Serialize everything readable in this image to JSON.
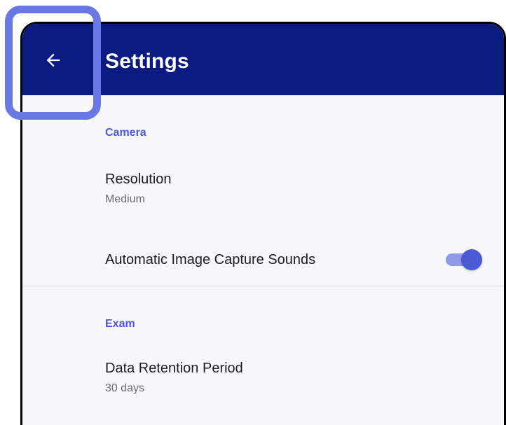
{
  "app_bar": {
    "title": "Settings",
    "back_icon": "arrow-left-icon",
    "background_color": "#0b1a7e"
  },
  "sections": {
    "camera": {
      "header": "Camera",
      "resolution": {
        "title": "Resolution",
        "value": "Medium"
      },
      "capture_sounds": {
        "title": "Automatic Image Capture Sounds",
        "enabled": true
      }
    },
    "exam": {
      "header": "Exam",
      "retention": {
        "title": "Data Retention Period",
        "value": "30 days"
      }
    }
  },
  "colors": {
    "accent": "#4a5ad3",
    "highlight": "#6978e2"
  }
}
